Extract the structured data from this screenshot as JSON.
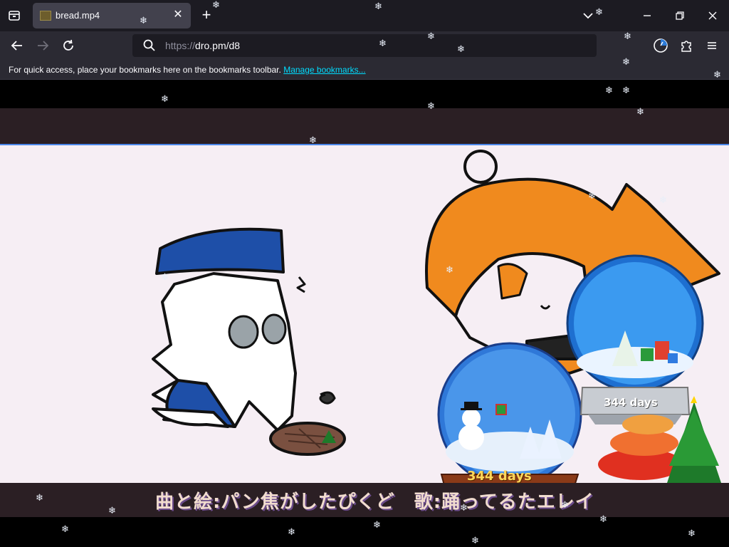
{
  "tab": {
    "title": "bread.mp4"
  },
  "url": {
    "prefix": "https://",
    "host": "dro.pm/d8"
  },
  "bookmarks": {
    "message": "For quick access, place your bookmarks here on the bookmarks toolbar.",
    "link": "Manage bookmarks..."
  },
  "video": {
    "subtitle": "曲と絵:パン焦がしたぴくど　歌:踊ってるたエレイ",
    "globe_days_1": "344 days",
    "globe_days_2": "344 days"
  },
  "icons": {
    "tab_list": "tab-list-icon",
    "close_tab": "close-icon",
    "new_tab": "plus-icon",
    "list_all_tabs": "chevron-down-icon",
    "minimize": "minimize-icon",
    "restore": "restore-icon",
    "close_window": "close-window-icon",
    "back": "back-arrow-icon",
    "forward": "forward-arrow-icon",
    "reload": "reload-icon",
    "search": "search-icon",
    "account": "account-icon",
    "extensions": "puzzle-icon",
    "menu": "hamburger-menu-icon",
    "snowflake": "snowflake-icon"
  },
  "colors": {
    "chrome_dark": "#1c1b22",
    "chrome": "#2b2a33",
    "link": "#00ddff",
    "video_bg": "#f6eef4"
  }
}
